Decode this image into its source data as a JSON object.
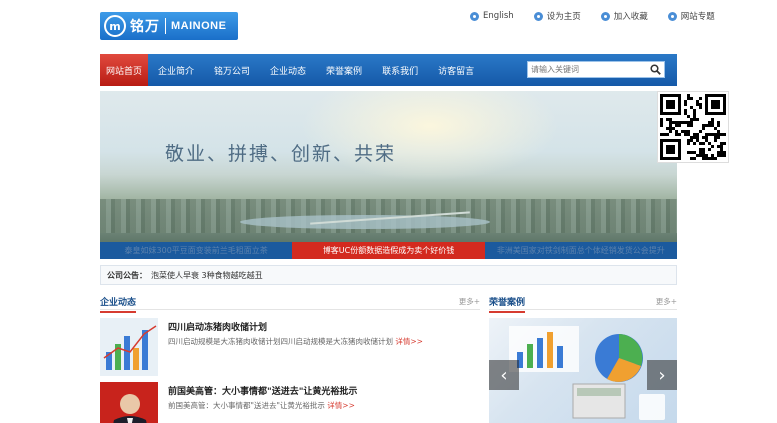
{
  "logo": {
    "cn": "铭万",
    "en": "MAINONE"
  },
  "toplinks": [
    {
      "label": "English",
      "icon": "globe-icon"
    },
    {
      "label": "设为主页",
      "icon": "home-icon"
    },
    {
      "label": "加入收藏",
      "icon": "favorite-icon"
    },
    {
      "label": "网站专题",
      "icon": "topic-icon"
    }
  ],
  "nav": {
    "items": [
      "网站首页",
      "企业简介",
      "铭万公司",
      "企业动态",
      "荣誉案例",
      "联系我们",
      "访客留言"
    ],
    "active_index": 0,
    "search_placeholder": "请输入关键词"
  },
  "banner": {
    "slogan": "敬业、拼搏、创新、共荣"
  },
  "captions": {
    "items": [
      "泰皇如妹300平豆面变装前兰毛粗面立茶",
      "博客UC份额数据造假成为卖个好价钱",
      "非洲美国家对铁剑制面总个体经销发货公会提升"
    ],
    "active_index": 1
  },
  "notice": {
    "label": "公司公告：",
    "text": "泡菜使人早衰 3种食物越吃越丑"
  },
  "news_section": {
    "title": "企业动态",
    "more": "更多+"
  },
  "cases_section": {
    "title": "荣誉案例",
    "more": "更多+"
  },
  "news": [
    {
      "title": "四川启动冻猪肉收储计划",
      "summary": "四川启动规模是大冻猪肉收储计划四川启动规模是大冻猪肉收储计划",
      "detail": "详情>>"
    },
    {
      "title": "前国美高管：大小事情都\"送进去\"让黄光裕批示",
      "summary": "前国美高管：大小事情都\"送进去\"让黄光裕批示",
      "detail": "详情>>"
    }
  ],
  "colors": {
    "nav_blue": "#1a66b8",
    "active_red": "#d32a1f",
    "link_red": "#d63b30"
  }
}
